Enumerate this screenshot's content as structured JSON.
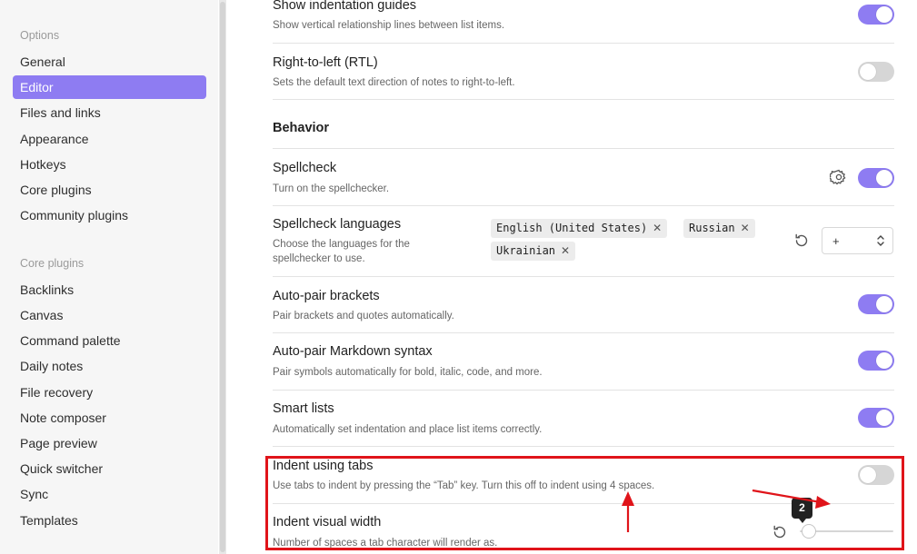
{
  "sidebar": {
    "options_header": "Options",
    "options_items": [
      {
        "label": "General"
      },
      {
        "label": "Editor"
      },
      {
        "label": "Files and links"
      },
      {
        "label": "Appearance"
      },
      {
        "label": "Hotkeys"
      },
      {
        "label": "Core plugins"
      },
      {
        "label": "Community plugins"
      }
    ],
    "active_item": "Editor",
    "core_plugins_header": "Core plugins",
    "core_plugin_items": [
      {
        "label": "Backlinks"
      },
      {
        "label": "Canvas"
      },
      {
        "label": "Command palette"
      },
      {
        "label": "Daily notes"
      },
      {
        "label": "File recovery"
      },
      {
        "label": "Note composer"
      },
      {
        "label": "Page preview"
      },
      {
        "label": "Quick switcher"
      },
      {
        "label": "Sync"
      },
      {
        "label": "Templates"
      }
    ]
  },
  "settings": {
    "indentation_guides": {
      "title": "Show indentation guides",
      "desc": "Show vertical relationship lines between list items.",
      "enabled": true
    },
    "rtl": {
      "title": "Right-to-left (RTL)",
      "desc": "Sets the default text direction of notes to right-to-left.",
      "enabled": false
    },
    "behavior_header": "Behavior",
    "spellcheck": {
      "title": "Spellcheck",
      "desc": "Turn on the spellchecker.",
      "enabled": true
    },
    "spellcheck_languages": {
      "title": "Spellcheck languages",
      "desc": "Choose the languages for the spellchecker to use.",
      "languages": [
        "English (United States)",
        "Russian",
        "Ukrainian"
      ],
      "dropdown_value": "+"
    },
    "auto_pair_brackets": {
      "title": "Auto-pair brackets",
      "desc": "Pair brackets and quotes automatically.",
      "enabled": true
    },
    "auto_pair_markdown": {
      "title": "Auto-pair Markdown syntax",
      "desc": "Pair symbols automatically for bold, italic, code, and more.",
      "enabled": true
    },
    "smart_lists": {
      "title": "Smart lists",
      "desc": "Automatically set indentation and place list items correctly.",
      "enabled": true
    },
    "indent_tabs": {
      "title": "Indent using tabs",
      "desc": "Use tabs to indent by pressing the “Tab” key. Turn this off to indent using 4 spaces.",
      "enabled": false
    },
    "indent_width": {
      "title": "Indent visual width",
      "desc": "Number of spaces a tab character will render as.",
      "value": 2,
      "tooltip": "2"
    }
  },
  "colors": {
    "accent": "#8e7cf2",
    "annotation": "#e0141a"
  }
}
